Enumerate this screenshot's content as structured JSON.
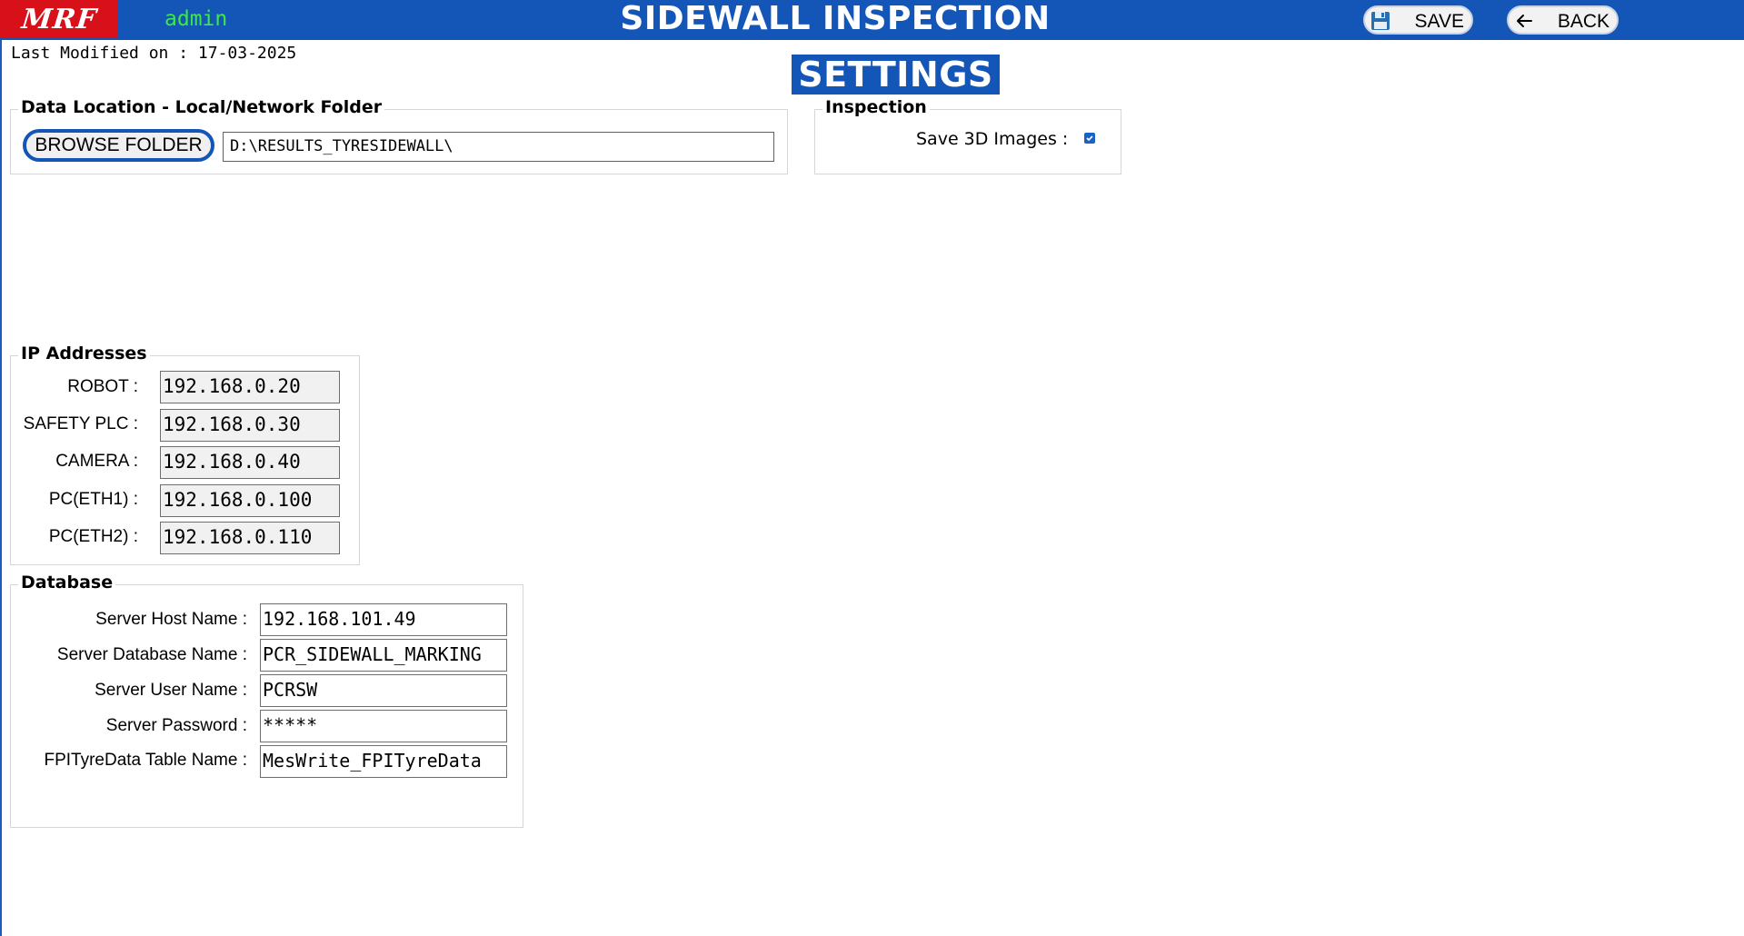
{
  "header": {
    "logo_text": "MRF",
    "user": "admin",
    "title": "SIDEWALL INSPECTION",
    "save_label": "SAVE",
    "back_label": "BACK",
    "colors": {
      "bar": "#1456b8",
      "logo_bg": "#d8101a",
      "user_text": "#3ee64a"
    }
  },
  "last_modified": "Last Modified on : 17-03-2025",
  "page_title": "SETTINGS",
  "data_location": {
    "title": "Data Location - Local/Network Folder",
    "browse_label": "BROWSE FOLDER",
    "path": "D:\\RESULTS_TYRESIDEWALL\\"
  },
  "inspection": {
    "title": "Inspection",
    "save_3d_label": "Save 3D Images :",
    "save_3d_checked": true
  },
  "ip_addresses": {
    "title": "IP Addresses",
    "rows": [
      {
        "label": "ROBOT :",
        "value": "192.168.0.20"
      },
      {
        "label": "SAFETY PLC :",
        "value": "192.168.0.30"
      },
      {
        "label": "CAMERA :",
        "value": "192.168.0.40"
      },
      {
        "label": "PC(ETH1) :",
        "value": "192.168.0.100"
      },
      {
        "label": "PC(ETH2) :",
        "value": "192.168.0.110"
      }
    ]
  },
  "database": {
    "title": "Database",
    "rows": [
      {
        "label": "Server Host Name :",
        "value": "192.168.101.49"
      },
      {
        "label": "Server Database Name :",
        "value": "PCR_SIDEWALL_MARKING"
      },
      {
        "label": "Server User Name :",
        "value": "PCRSW"
      },
      {
        "label": "Server Password :",
        "value": "*****"
      },
      {
        "label": "FPITyreData Table Name :",
        "value": "MesWrite_FPITyreData"
      }
    ]
  }
}
